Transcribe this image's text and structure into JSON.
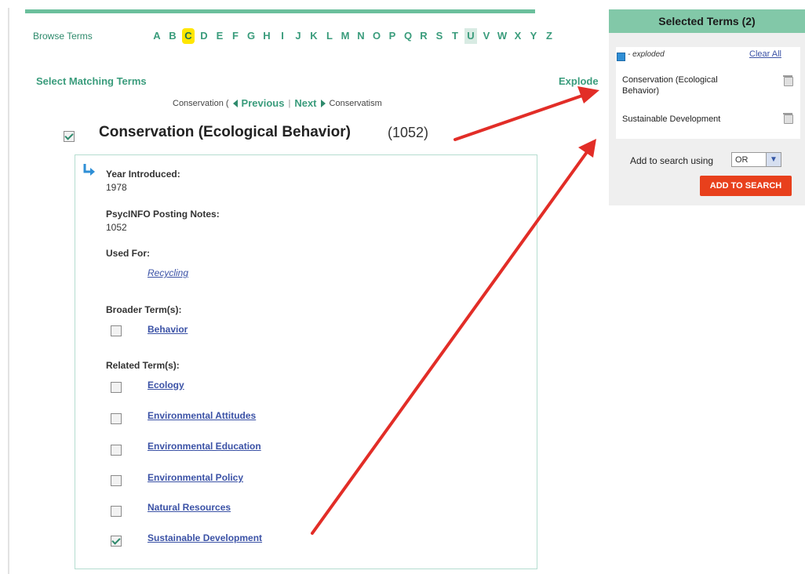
{
  "browse": {
    "label": "Browse Terms",
    "letters": [
      "A",
      "B",
      "C",
      "D",
      "E",
      "F",
      "G",
      "H",
      "I",
      "J",
      "K",
      "L",
      "M",
      "N",
      "O",
      "P",
      "Q",
      "R",
      "S",
      "T",
      "U",
      "V",
      "W",
      "X",
      "Y",
      "Z"
    ],
    "active_letter": "C"
  },
  "select_heading": "Select Matching Terms",
  "explode_label": "Explode",
  "pager": {
    "previous_term": "Conservation (",
    "previous_label": "Previous",
    "separator": "|",
    "next_label": "Next",
    "next_term": "Conservatism"
  },
  "main_term": {
    "name": "Conservation (Ecological Behavior)",
    "count": "(1052)",
    "checked": true
  },
  "details": {
    "year_label": "Year Introduced:",
    "year_value": "1978",
    "notes_label": "PsycINFO Posting Notes:",
    "notes_value": "1052",
    "used_for_label": "Used For:",
    "used_for": [
      "Recycling"
    ],
    "broader_label": "Broader Term(s):",
    "broader": [
      {
        "label": "Behavior",
        "checked": false
      }
    ],
    "related_label": "Related Term(s):",
    "related": [
      {
        "label": "Ecology",
        "checked": false
      },
      {
        "label": "Environmental Attitudes",
        "checked": false
      },
      {
        "label": "Environmental Education",
        "checked": false
      },
      {
        "label": "Environmental Policy",
        "checked": false
      },
      {
        "label": "Natural Resources",
        "checked": false
      },
      {
        "label": "Sustainable Development",
        "checked": true
      }
    ]
  },
  "selected_panel": {
    "title": "Selected Terms (2)",
    "legend_text": "- exploded",
    "clear_all": "Clear All",
    "items": [
      {
        "label": "Conservation (Ecological Behavior)"
      },
      {
        "label": "Sustainable Development"
      }
    ],
    "add_label": "Add to search using",
    "operator": "OR",
    "button": "ADD TO SEARCH"
  },
  "colors": {
    "accent": "#3a9c7c",
    "panel_header": "#82c8a8",
    "link": "#3b52a6",
    "add_button": "#e8401c",
    "annotation_arrow": "#e22d27",
    "active_letter": "#ffe600"
  },
  "icons": [
    "checkbox-icon",
    "trash-icon",
    "chevron-left-icon",
    "chevron-right-icon",
    "related-arrow-icon",
    "dropdown-chevron-icon",
    "explode-icon"
  ]
}
